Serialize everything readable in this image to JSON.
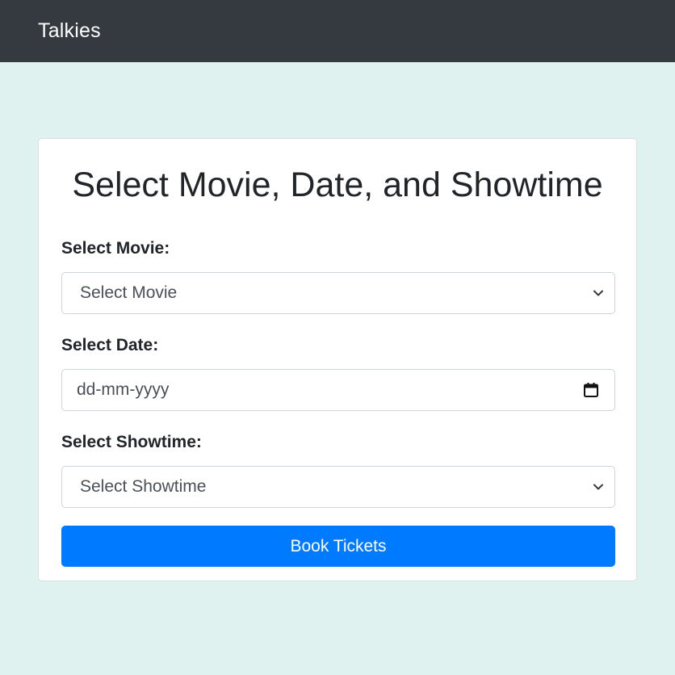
{
  "navbar": {
    "brand": "Talkies"
  },
  "form": {
    "title": "Select Movie, Date, and Showtime",
    "movie": {
      "label": "Select Movie:",
      "value": "Select Movie",
      "icon": "chevron-down-icon"
    },
    "date": {
      "label": "Select Date:",
      "value": "dd-mm-yyyy",
      "icon": "calendar-icon"
    },
    "showtime": {
      "label": "Select Showtime:",
      "value": "Select Showtime",
      "icon": "chevron-down-icon"
    },
    "submit_label": "Book Tickets"
  },
  "colors": {
    "navbar_bg": "#343a40",
    "page_bg": "#dff2f0",
    "primary": "#007bff"
  }
}
